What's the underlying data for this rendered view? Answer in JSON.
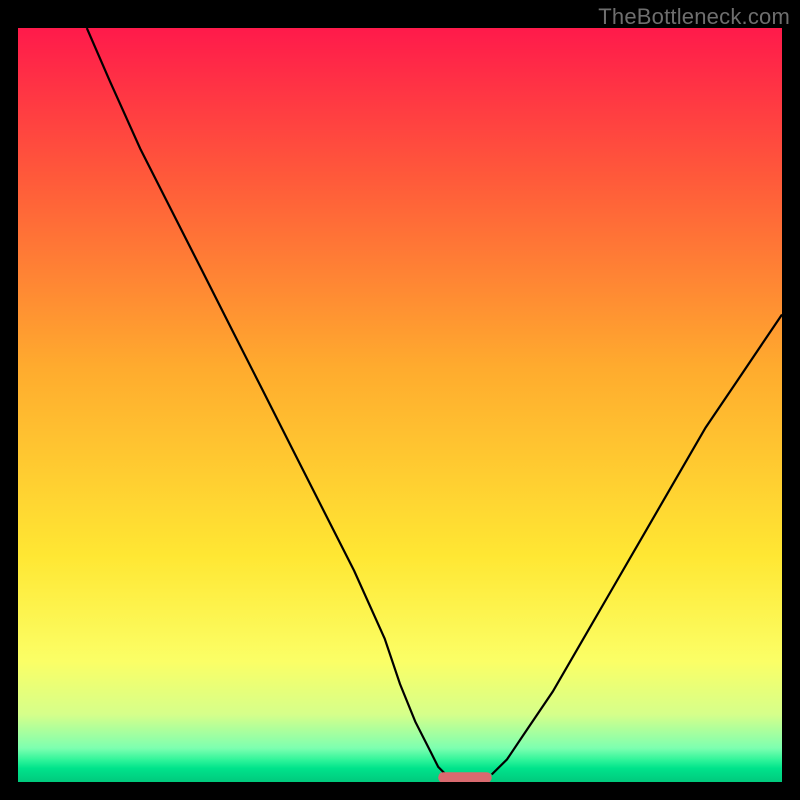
{
  "watermark": "TheBottleneck.com",
  "chart_data": {
    "type": "line",
    "title": "",
    "xlabel": "",
    "ylabel": "",
    "xlim": [
      0,
      100
    ],
    "ylim": [
      0,
      100
    ],
    "grid": false,
    "legend": false,
    "background_gradient_stops": [
      {
        "offset": 0.0,
        "color": "#ff1a4b"
      },
      {
        "offset": 0.2,
        "color": "#ff5a3a"
      },
      {
        "offset": 0.45,
        "color": "#ffab2e"
      },
      {
        "offset": 0.7,
        "color": "#ffe733"
      },
      {
        "offset": 0.84,
        "color": "#fbff66"
      },
      {
        "offset": 0.91,
        "color": "#d6ff8a"
      },
      {
        "offset": 0.955,
        "color": "#7dffb0"
      },
      {
        "offset": 0.97,
        "color": "#33f59b"
      },
      {
        "offset": 0.982,
        "color": "#00e38b"
      },
      {
        "offset": 1.0,
        "color": "#00c97d"
      }
    ],
    "series": [
      {
        "name": "bottleneck-curve-left",
        "color": "#000000",
        "x": [
          9,
          12,
          16,
          20,
          24,
          28,
          32,
          36,
          40,
          44,
          48,
          50,
          52,
          54,
          55,
          56
        ],
        "y": [
          100,
          93,
          84,
          76,
          68,
          60,
          52,
          44,
          36,
          28,
          19,
          13,
          8,
          4,
          2,
          1
        ]
      },
      {
        "name": "bottleneck-curve-right",
        "color": "#000000",
        "x": [
          62,
          64,
          66,
          70,
          74,
          78,
          82,
          86,
          90,
          94,
          98,
          100
        ],
        "y": [
          1,
          3,
          6,
          12,
          19,
          26,
          33,
          40,
          47,
          53,
          59,
          62
        ]
      }
    ],
    "marker": {
      "name": "optimal-band",
      "color": "#d96a6f",
      "x_center": 58.5,
      "y": 0.6,
      "width": 7,
      "height": 1.4
    }
  }
}
